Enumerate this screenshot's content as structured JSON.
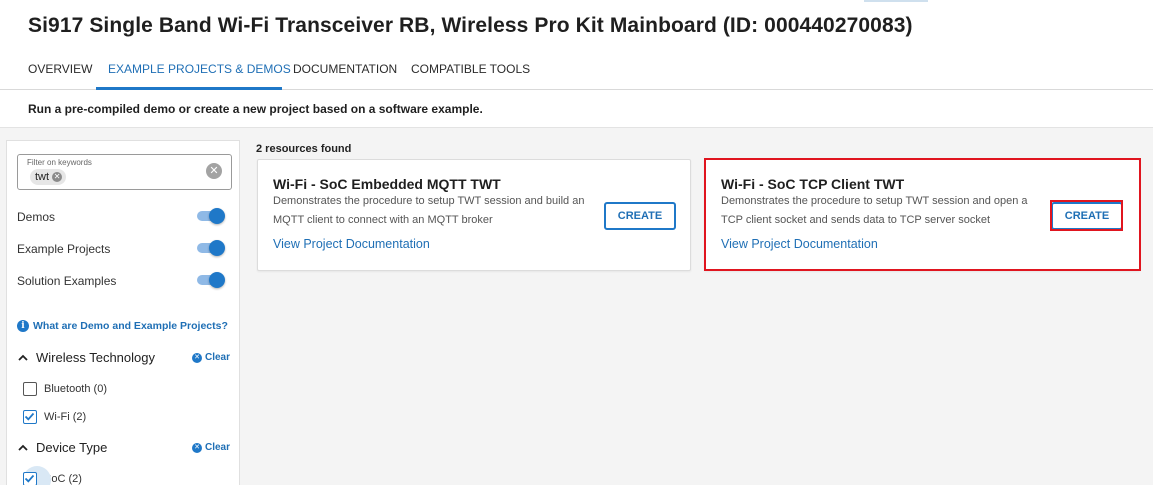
{
  "header": {
    "title": "Si917 Single Band Wi-Fi Transceiver RB, Wireless Pro Kit Mainboard (ID: 000440270083)",
    "tabs": [
      {
        "label": "OVERVIEW",
        "active": false
      },
      {
        "label": "EXAMPLE PROJECTS & DEMOS",
        "active": true
      },
      {
        "label": "DOCUMENTATION",
        "active": false
      },
      {
        "label": "COMPATIBLE TOOLS",
        "active": false
      }
    ]
  },
  "intro": "Run a pre-compiled demo or create a new project based on a software example.",
  "sidebar": {
    "filter": {
      "label": "Filter on keywords",
      "chip": "twt",
      "chip_remove_icon": "close-icon",
      "clear_icon": "close-circle-icon"
    },
    "toggles": [
      {
        "label": "Demos",
        "on": true
      },
      {
        "label": "Example Projects",
        "on": true
      },
      {
        "label": "Solution Examples",
        "on": true
      }
    ],
    "help_link": "What are Demo and Example Projects?",
    "sections": [
      {
        "title": "Wireless Technology",
        "clear_label": "Clear",
        "items": [
          {
            "label": "Bluetooth (0)",
            "checked": false
          },
          {
            "label": "Wi-Fi (2)",
            "checked": true
          }
        ]
      },
      {
        "title": "Device Type",
        "clear_label": "Clear",
        "items": [
          {
            "label": "SoC (2)",
            "checked": true
          }
        ]
      }
    ]
  },
  "results": {
    "count_label": "2 resources found",
    "cards": [
      {
        "title": "Wi-Fi - SoC Embedded MQTT TWT",
        "desc_line1": "Demonstrates the procedure to setup TWT session and build an",
        "desc_line2": "MQTT client to connect with an MQTT broker",
        "link": "View Project Documentation",
        "button": "CREATE",
        "highlighted": false
      },
      {
        "title": "Wi-Fi - SoC TCP Client TWT",
        "desc_line1": "Demonstrates the procedure to setup TWT session and open a",
        "desc_line2": "TCP client socket and sends data to TCP server socket",
        "link": "View Project Documentation",
        "button": "CREATE",
        "highlighted": true
      }
    ]
  },
  "colors": {
    "accent": "#1f78c8",
    "highlight": "#e0151f"
  }
}
